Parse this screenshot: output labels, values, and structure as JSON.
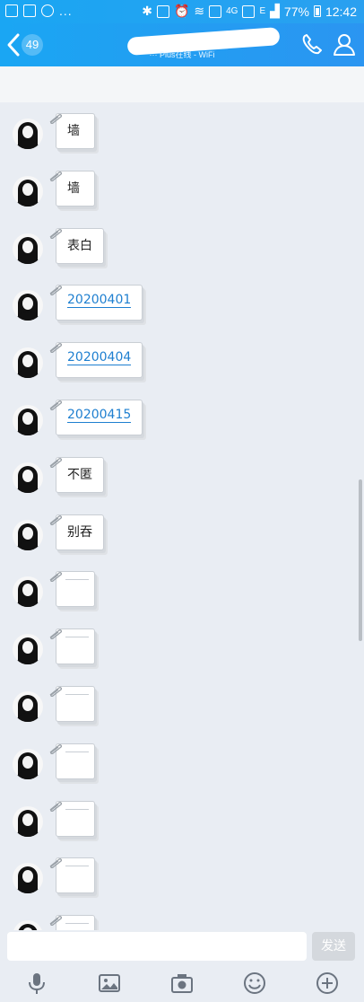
{
  "status_bar": {
    "battery": "77%",
    "time": "12:42",
    "network": "4G",
    "network_secondary": "E",
    "overflow": "..."
  },
  "header": {
    "unread_count": "49",
    "subtitle": "··· Plus在线 - WiFi",
    "icons": [
      "back-icon",
      "phone-icon",
      "profile-icon"
    ]
  },
  "messages": [
    {
      "text": "墙",
      "kind": "text"
    },
    {
      "text": "墙",
      "kind": "text"
    },
    {
      "text": "表白",
      "kind": "text"
    },
    {
      "text": "20200401",
      "kind": "link"
    },
    {
      "text": "20200404",
      "kind": "link"
    },
    {
      "text": "20200415",
      "kind": "link"
    },
    {
      "text": "不匿",
      "kind": "text"
    },
    {
      "text": "别吞",
      "kind": "text"
    },
    {
      "text": "",
      "kind": "blank"
    },
    {
      "text": "",
      "kind": "blank"
    },
    {
      "text": "",
      "kind": "blank"
    },
    {
      "text": "",
      "kind": "blank"
    },
    {
      "text": "",
      "kind": "blank"
    },
    {
      "text": "",
      "kind": "blank"
    },
    {
      "text": "",
      "kind": "blank"
    }
  ],
  "composer": {
    "value": "",
    "send_label": "发送"
  },
  "toolbar": {
    "icons": [
      "microphone-icon",
      "image-icon",
      "camera-icon",
      "emoji-icon",
      "plus-icon"
    ]
  },
  "colors": {
    "header": "#1aa6f3",
    "link": "#1e7fd0",
    "background": "#e9edf3"
  }
}
